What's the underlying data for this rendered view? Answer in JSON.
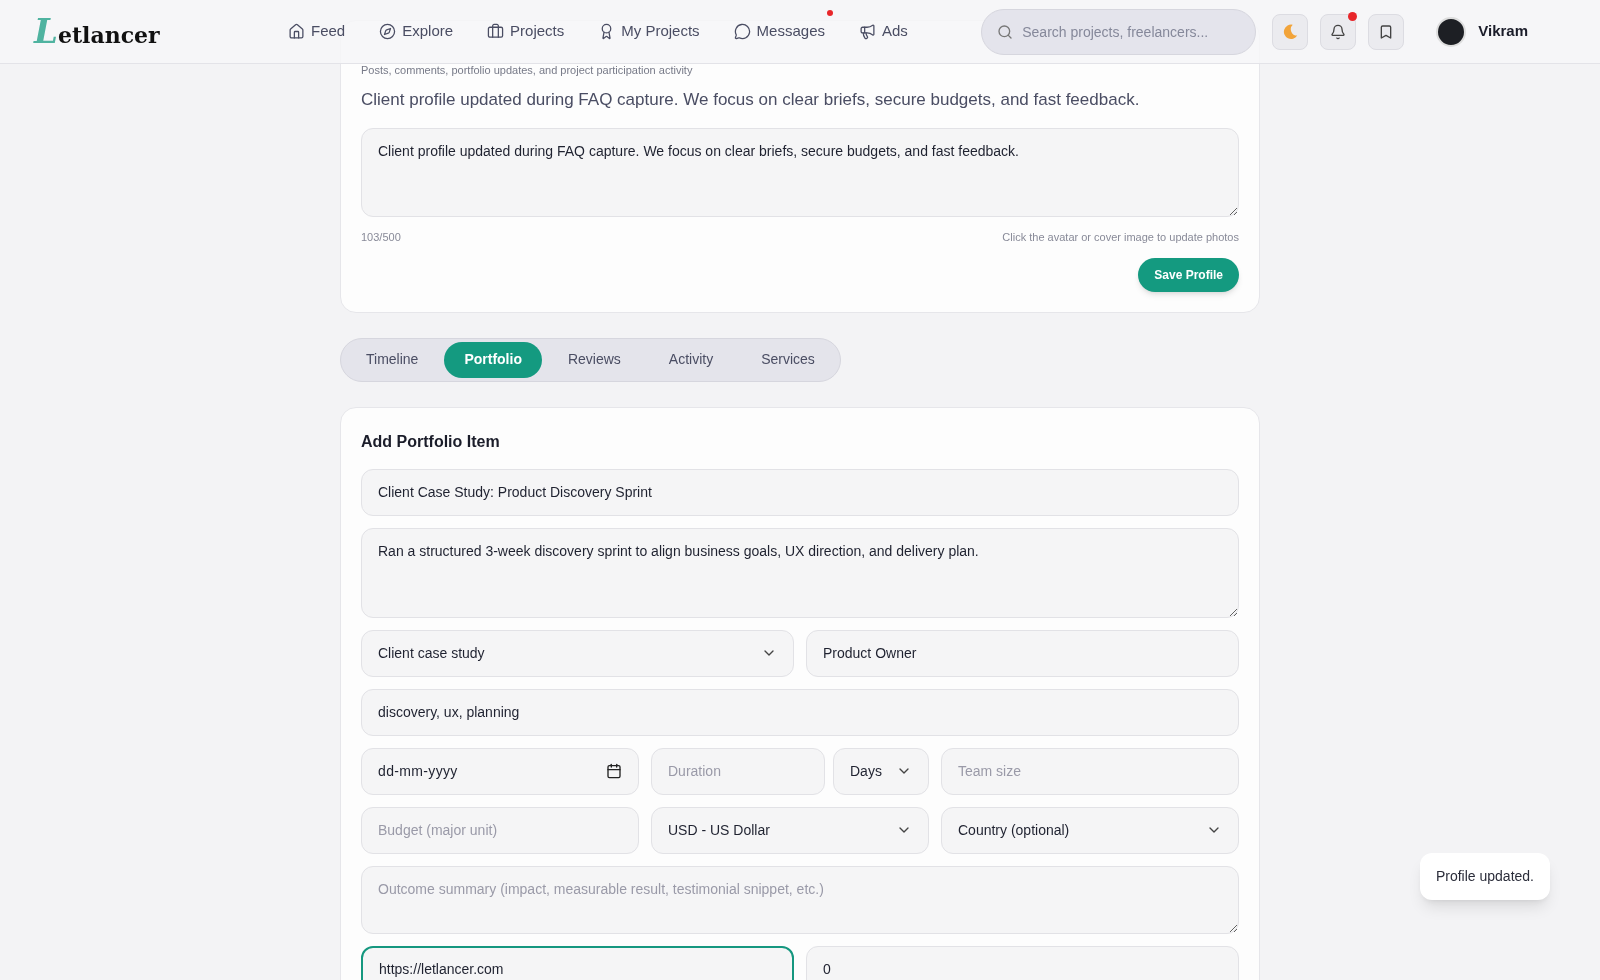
{
  "header": {
    "logo": "Letlancer",
    "nav": [
      {
        "label": "Feed",
        "dot": false
      },
      {
        "label": "Explore",
        "dot": false
      },
      {
        "label": "Projects",
        "dot": false
      },
      {
        "label": "My Projects",
        "dot": false
      },
      {
        "label": "Messages",
        "dot": true
      },
      {
        "label": "Ads",
        "dot": false
      }
    ],
    "search": {
      "placeholder": "Search projects, freelancers..."
    },
    "notifications": {
      "dot": true
    },
    "user": {
      "name": "Vikram"
    }
  },
  "profile_card": {
    "subtitle": "Posts, comments, portfolio updates, and project participation activity",
    "bio": "Client profile updated during FAQ capture. We focus on clear briefs, secure budgets, and fast feedback.",
    "bio_field": {
      "value": "Client profile updated during FAQ capture. We focus on clear briefs, secure budgets, and fast feedback."
    },
    "counter": "103/500",
    "hint": "Click the avatar or cover image to update photos",
    "save_button": "Save Profile"
  },
  "tabs": [
    {
      "label": "Timeline",
      "selected": false
    },
    {
      "label": "Portfolio",
      "selected": true
    },
    {
      "label": "Reviews",
      "selected": false
    },
    {
      "label": "Activity",
      "selected": false
    },
    {
      "label": "Services",
      "selected": false
    }
  ],
  "portfolio_form": {
    "title": "Add Portfolio Item",
    "title_field": {
      "kind": "input",
      "value": "Client Case Study: Product Discovery Sprint",
      "focused": false
    },
    "description_field": {
      "kind": "textarea",
      "value": "Ran a structured 3-week discovery sprint to align business goals, UX direction, and delivery plan.",
      "focused": false
    },
    "type_and_role": [
      {
        "kind": "select",
        "value": "Client case study",
        "focused": false
      },
      {
        "kind": "input",
        "value": "Product Owner",
        "focused": false
      }
    ],
    "tags_field": {
      "kind": "input",
      "value": "discovery, ux, planning",
      "focused": false
    },
    "schedule": {
      "date": {
        "kind": "date",
        "value": "dd-mm-yyyy",
        "focused": false
      },
      "duration": {
        "kind": "input",
        "placeholder": "Duration",
        "focused": false
      },
      "unit": {
        "kind": "select",
        "value": "Days",
        "focused": false
      },
      "team_size": {
        "kind": "input",
        "placeholder": "Team size",
        "focused": false
      }
    },
    "budget": {
      "amount": {
        "kind": "input",
        "placeholder": "Budget (major unit)",
        "focused": false
      },
      "currency": {
        "kind": "select",
        "value": "USD - US Dollar",
        "focused": false
      },
      "country": {
        "kind": "select",
        "value": "Country (optional)",
        "focused": false
      }
    },
    "outcome_field": {
      "kind": "textarea",
      "placeholder": "Outcome summary (impact, measurable result, testimonial snippet, etc.)",
      "focused": false
    },
    "link_and_order": [
      {
        "kind": "input",
        "value": "https://letlancer.com",
        "focused": true
      },
      {
        "kind": "input",
        "value": "0",
        "focused": false
      }
    ]
  },
  "toast": "Profile updated."
}
